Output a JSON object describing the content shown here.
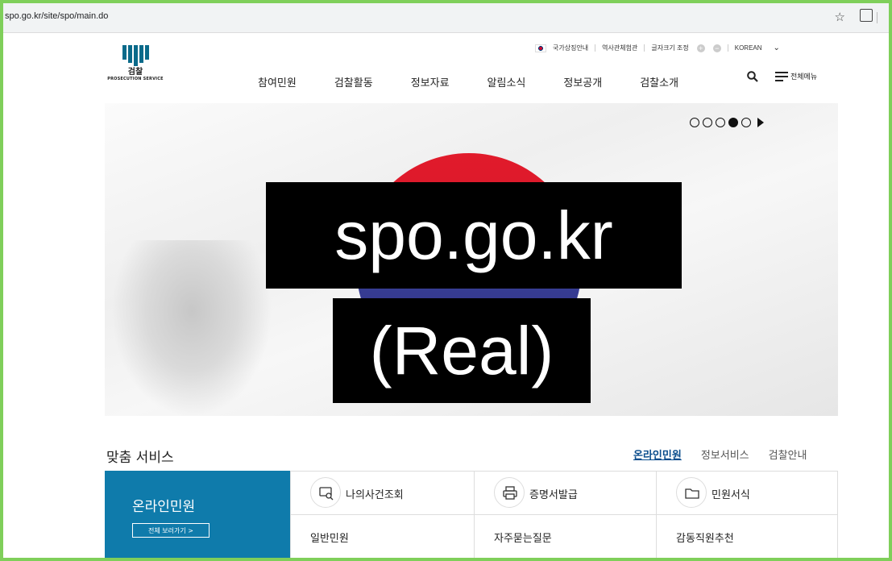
{
  "browser": {
    "url": "spo.go.kr/site/spo/main.do",
    "star_icon": "star-icon",
    "extension_icon": "extension-icon"
  },
  "utility": {
    "items": [
      "국가상징안내",
      "역사관체험관",
      "글자크기 조정"
    ],
    "plus": "+",
    "minus": "−",
    "language": "KOREAN"
  },
  "logo": {
    "ko": "검찰",
    "en": "PROSECUTION SERVICE"
  },
  "gnb": [
    "참여민원",
    "검찰활동",
    "정보자료",
    "알림소식",
    "정보공개",
    "검찰소개"
  ],
  "allmenu_label": "전체메뉴",
  "hero": {
    "overlay_line1": "spo.go.kr",
    "overlay_line2": "(Real)",
    "slides_total": 5,
    "slide_active": 4
  },
  "services": {
    "title": "맞춤 서비스",
    "tabs": [
      "온라인민원",
      "정보서비스",
      "검찰안내"
    ],
    "active_tab": 0,
    "panel": {
      "title": "온라인민원",
      "button": "전체 보러가기  >"
    },
    "cells": [
      "나의사건조회",
      "증명서발급",
      "민원서식",
      "일반민원",
      "자주묻는질문",
      "감동직원추천"
    ]
  },
  "colors": {
    "accent": "#0f7bab",
    "active_tab": "#0a4d8c",
    "frame": "#7fcf5a"
  }
}
